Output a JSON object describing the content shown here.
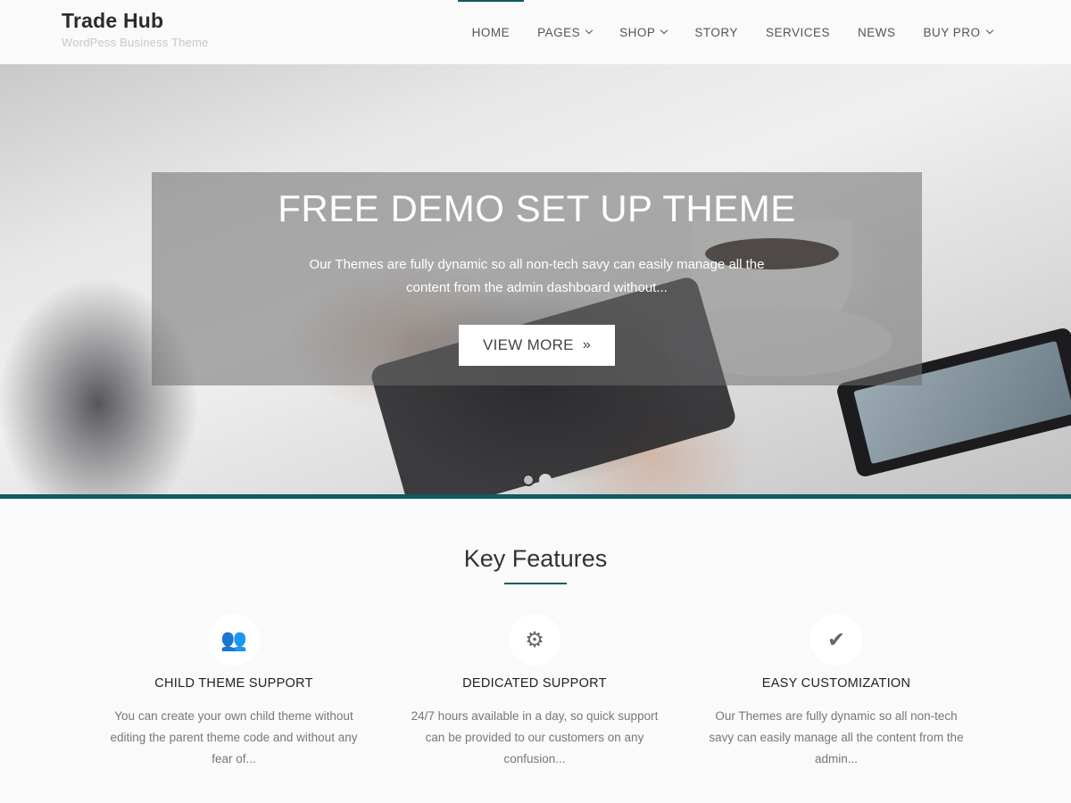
{
  "brand": {
    "title": "Trade Hub",
    "tagline": "WordPess Business Theme"
  },
  "nav": {
    "items": [
      {
        "label": "HOME",
        "dropdown": false,
        "active": true
      },
      {
        "label": "PAGES",
        "dropdown": true,
        "active": false
      },
      {
        "label": "SHOP",
        "dropdown": true,
        "active": false
      },
      {
        "label": "STORY",
        "dropdown": false,
        "active": false
      },
      {
        "label": "SERVICES",
        "dropdown": false,
        "active": false
      },
      {
        "label": "NEWS",
        "dropdown": false,
        "active": false
      },
      {
        "label": "BUY PRO",
        "dropdown": true,
        "active": false
      }
    ]
  },
  "hero": {
    "title": "FREE DEMO SET UP THEME",
    "text": "Our Themes are fully dynamic so all non-tech savy can easily manage all the content from the admin dashboard without...",
    "button_label": "VIEW MORE",
    "button_icon": "»",
    "slides": 2,
    "active_slide": 1
  },
  "features": {
    "title": "Key Features",
    "items": [
      {
        "icon": "users-icon",
        "glyph": "👥",
        "title": "CHILD THEME SUPPORT",
        "text": "You can create your own child theme without editing the parent theme code and without any fear of..."
      },
      {
        "icon": "gear-icon",
        "glyph": "⚙",
        "title": "DEDICATED SUPPORT",
        "text": "24/7 hours available in a day, so quick support can be provided to our customers on any confusion..."
      },
      {
        "icon": "checkmark-icon",
        "glyph": "✔",
        "title": "EASY CUSTOMIZATION",
        "text": "Our Themes are fully dynamic so all non-tech savy can easily manage all the content from the admin..."
      }
    ]
  },
  "colors": {
    "accent": "#0f5a63",
    "background": "#fafafa"
  }
}
